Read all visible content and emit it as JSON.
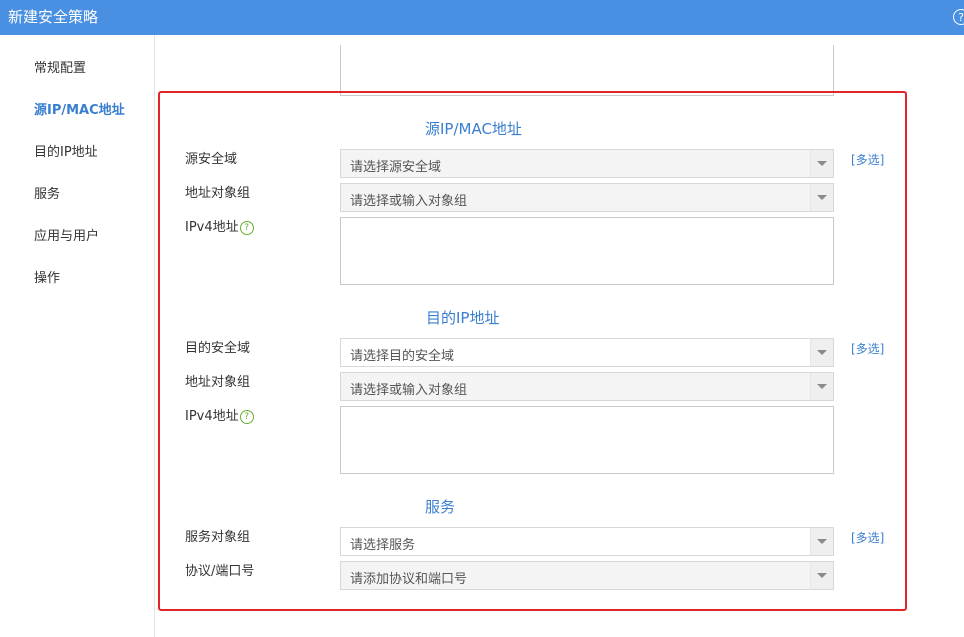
{
  "window": {
    "title": "新建安全策略",
    "help_glyph": "?"
  },
  "sidebar": {
    "items": [
      {
        "label": "常规配置",
        "active": false
      },
      {
        "label": "源IP/MAC地址",
        "active": true
      },
      {
        "label": "目的IP地址",
        "active": false
      },
      {
        "label": "服务",
        "active": false
      },
      {
        "label": "应用与用户",
        "active": false
      },
      {
        "label": "操作",
        "active": false
      }
    ]
  },
  "source": {
    "title": "源IP/MAC地址",
    "zone_label": "源安全域",
    "zone_placeholder": "请选择源安全域",
    "group_label": "地址对象组",
    "group_placeholder": "请选择或输入对象组",
    "ipv4_label": "IPv4地址",
    "multi_label": "[多选]"
  },
  "destination": {
    "title": "目的IP地址",
    "zone_label": "目的安全域",
    "zone_placeholder": "请选择目的安全域",
    "group_label": "地址对象组",
    "group_placeholder": "请选择或输入对象组",
    "ipv4_label": "IPv4地址",
    "multi_label": "[多选]"
  },
  "service": {
    "title": "服务",
    "group_label": "服务对象组",
    "group_placeholder": "请选择服务",
    "protocol_label": "协议/端口号",
    "protocol_placeholder": "请添加协议和端口号",
    "multi_label": "[多选]"
  },
  "icons": {
    "help": "question-circle-icon",
    "dropdown": "chevron-down-icon"
  },
  "colors": {
    "titlebar": "#4a90e2",
    "accent": "#3a7fcf",
    "highlight": "#e0262b",
    "help_icon": "#6ab02e"
  }
}
